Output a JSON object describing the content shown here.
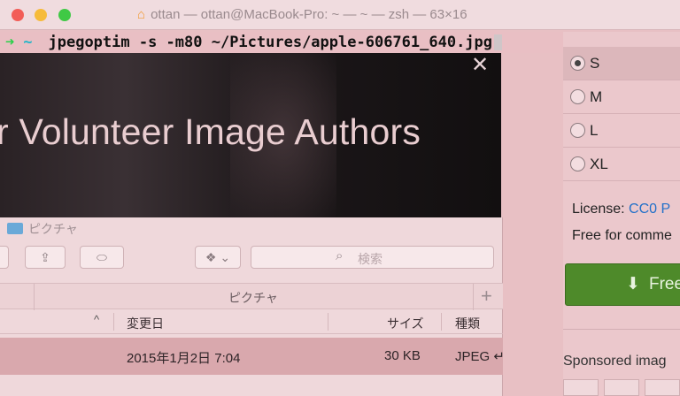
{
  "window": {
    "title": "ottan — ottan@MacBook-Pro: ~ — ~ — zsh — 63×16"
  },
  "terminal": {
    "arrow": "➜",
    "cwd": "~",
    "command": "jpegoptim -s -m80 ~/Pictures/apple-606761_640.jpg"
  },
  "overlay": {
    "headline": "r Volunteer Image Authors",
    "close_glyph": "✕"
  },
  "finder": {
    "title": "ピクチャ",
    "search_placeholder": "検索",
    "path_label": "ピクチャ",
    "add_tab": "+",
    "columns": {
      "modified": "変更日",
      "size": "サイズ",
      "kind": "種類"
    },
    "rows": [
      {
        "date": "2015年1月2日 7:04",
        "size": "30 KB",
        "kind": "JPEG ↵"
      }
    ]
  },
  "download_panel": {
    "sizes": [
      {
        "label": "S",
        "selected": true
      },
      {
        "label": "M",
        "selected": false
      },
      {
        "label": "L",
        "selected": false
      },
      {
        "label": "XL",
        "selected": false
      }
    ],
    "license_label": "License:",
    "license_value": "CC0 P",
    "free_text": "Free for comme",
    "download_label": "Free",
    "sponsored_label": "Sponsored imag"
  },
  "colors": {
    "download_button": "#4e8a2a",
    "link": "#2170c9",
    "prompt_arrow": "#2bd14a",
    "prompt_cwd": "#1fb5c8"
  }
}
